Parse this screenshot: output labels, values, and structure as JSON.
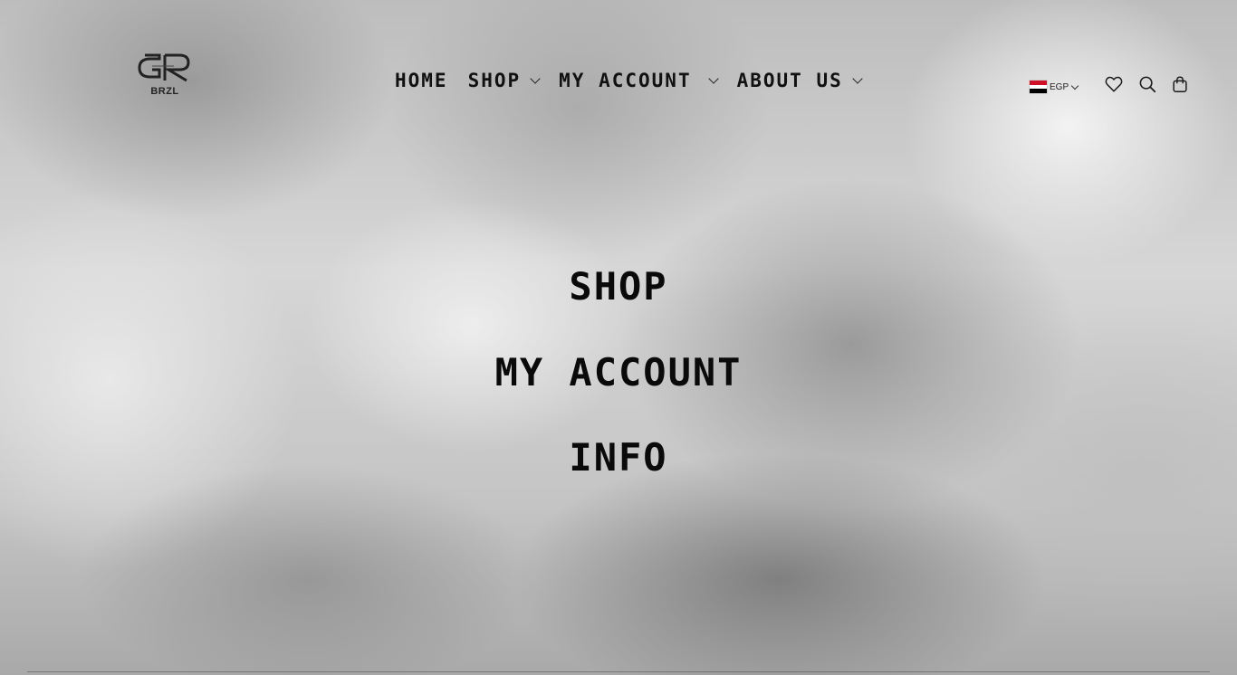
{
  "header": {
    "logo": {
      "text": "BRZL",
      "icon": "brand-logo"
    },
    "nav": [
      {
        "label": "Home",
        "has_dropdown": false
      },
      {
        "label": "Shop",
        "has_dropdown": true
      },
      {
        "label": "My Account",
        "has_dropdown": true
      },
      {
        "label": "About Us",
        "has_dropdown": true
      }
    ],
    "currency": {
      "label": "EGP",
      "flag": "egypt-flag-icon"
    },
    "icons": [
      "heart-icon",
      "search-icon",
      "bag-icon"
    ]
  },
  "main": {
    "links": [
      {
        "label": "Shop"
      },
      {
        "label": "My Account"
      },
      {
        "label": "Info"
      }
    ]
  },
  "colors": {
    "text": "#111111",
    "flag_red": "#ce1126",
    "flag_white": "#ffffff",
    "flag_black": "#000000"
  }
}
